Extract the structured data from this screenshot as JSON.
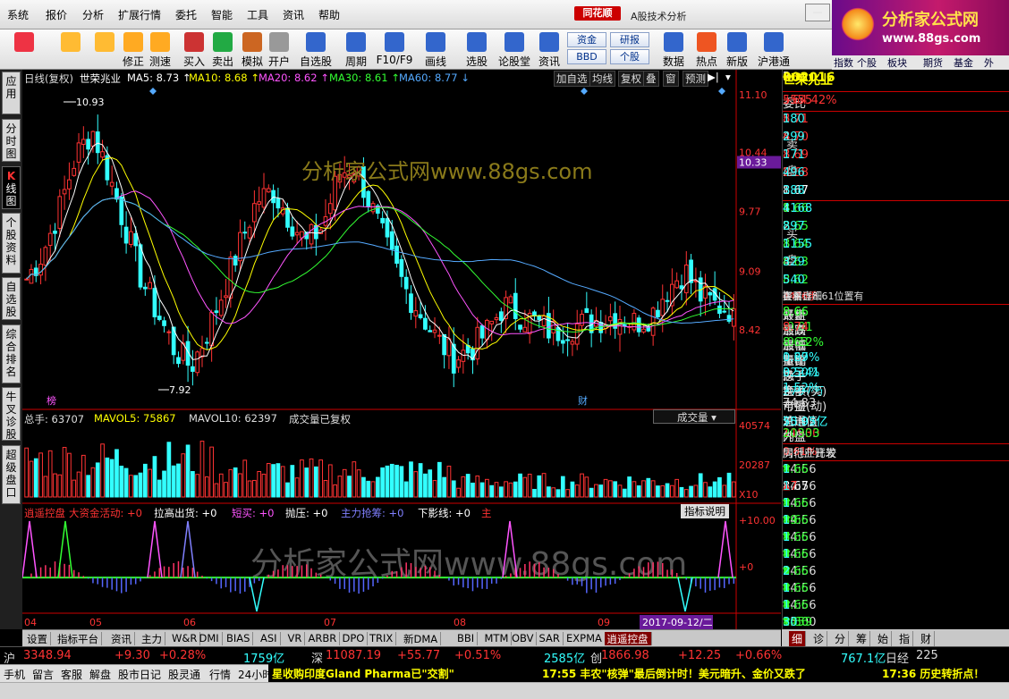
{
  "menu": [
    "系统",
    "报价",
    "分析",
    "扩展行情",
    "委托",
    "智能",
    "工具",
    "资讯",
    "帮助"
  ],
  "app": {
    "logo": "同花顺",
    "title": "A股技术分析",
    "brand_line1": "分析家公式网",
    "brand_line2": "www.88gs.com"
  },
  "toolbar": [
    {
      "label": "",
      "icon": "grid-icon"
    },
    {
      "label": "",
      "icon": "back-arrow-icon"
    },
    {
      "label": "",
      "icon": "up-down-icon"
    },
    {
      "label": "修正",
      "icon": "fix-icon"
    },
    {
      "label": "测速",
      "icon": "clock-icon"
    },
    {
      "label": "买入",
      "icon": "buy-icon"
    },
    {
      "label": "卖出",
      "icon": "sell-icon"
    },
    {
      "label": "模拟",
      "icon": "hammer-icon"
    },
    {
      "label": "开户",
      "icon": "lock-icon"
    },
    {
      "label": "自选股",
      "icon": "star-icon"
    },
    {
      "label": "周期",
      "icon": "period-icon"
    },
    {
      "label": "F10/F9",
      "icon": "f10-icon"
    },
    {
      "label": "画线",
      "icon": "pencil-icon"
    },
    {
      "label": "选股",
      "icon": "select-icon"
    },
    {
      "label": "论股堂",
      "icon": "forum-icon"
    },
    {
      "label": "资讯",
      "icon": "news-icon"
    },
    {
      "label": "数据",
      "icon": "pe-icon"
    },
    {
      "label": "热点",
      "icon": "fire-icon"
    },
    {
      "label": "新版",
      "icon": "newversion-icon"
    },
    {
      "label": "沪港通",
      "icon": "hk-icon"
    }
  ],
  "toolbar_small": [
    "资金",
    "研报",
    "BBD",
    "个股"
  ],
  "right_toolbar": [
    "指数",
    "个股",
    "板块",
    "期货",
    "基金",
    "外"
  ],
  "left_tabs": [
    "应用",
    "分时图",
    "K线图",
    "个股资料",
    "自选股",
    "综合排名",
    "牛叉诊股",
    "超级盘口"
  ],
  "kline_header": {
    "period": "日线(复权)",
    "stock": "世荣兆业",
    "ma": [
      {
        "label": "MA5: 8.73",
        "color": "#ffffff"
      },
      {
        "label": "MA10: 8.68",
        "color": "#ffff00"
      },
      {
        "label": "MA20: 8.62",
        "color": "#ff55ff"
      },
      {
        "label": "MA30: 8.61",
        "color": "#33ff33"
      },
      {
        "label": "MA60: 8.77",
        "color": "#55aaff"
      }
    ],
    "buttons": [
      "加自选",
      "均线",
      "复权",
      "叠",
      "窗",
      "预测"
    ]
  },
  "price_axis": [
    "11.10",
    "10.44",
    "10.33",
    "9.77",
    "9.09",
    "8.42"
  ],
  "current_price_tag": "10.33",
  "high_label": "10.93",
  "low_label": "7.92",
  "markers": [
    "榜",
    "财"
  ],
  "watermark": "分析家公式网www.88gs.com",
  "volume_header": {
    "total": "总手: 63707",
    "mavol5": "MAVOL5: 75867",
    "mavol10": "MAVOL10: 62397",
    "note": "成交量已复权",
    "select": "成交量"
  },
  "volume_axis": [
    "40574",
    "20287",
    "X10"
  ],
  "indicator_header": {
    "name": "逍遥控盘",
    "items": [
      {
        "label": "大资金活动: +0",
        "color": "#ff3333"
      },
      {
        "label": "拉高出货: +0",
        "color": "#ffffff"
      },
      {
        "label": "短买: +0",
        "color": "#ff55ff"
      },
      {
        "label": "抛压: +0",
        "color": "#ffffff"
      },
      {
        "label": "主力抢筹: +0",
        "color": "#8080ff"
      },
      {
        "label": "下影线: +0",
        "color": "#ffffff"
      },
      {
        "label": "主",
        "color": "#ff3333"
      }
    ],
    "help": "指标说明"
  },
  "indicator_axis": [
    "+10.00",
    "+0"
  ],
  "month_labels": [
    "04",
    "05",
    "06",
    "07",
    "08",
    "09"
  ],
  "date_tag": "2017-09-12/二",
  "bottom_tabs": [
    "设置",
    "指标平台",
    "资讯",
    "主力",
    "W&R",
    "DMI",
    "BIAS",
    "ASI",
    "VR",
    "ARBR",
    "DPO",
    "TRIX",
    "新DMA",
    "BBI",
    "MTM",
    "OBV",
    "SAR",
    "EXPMA",
    "逍遥控盘"
  ],
  "right_panel": {
    "title": "世荣兆业",
    "code": "002016",
    "mark": "R",
    "weibi": {
      "label": "委比",
      "value": "+64.42%",
      "vol": "5555"
    },
    "sell_label": "卖盘",
    "buy_label": "买盘",
    "sell": [
      {
        "n": "5",
        "p": "8.71",
        "v": "180"
      },
      {
        "n": "4",
        "p": "8.70",
        "v": "299"
      },
      {
        "n": "3",
        "p": "8.69",
        "v": "171"
      },
      {
        "n": "2",
        "p": "8.68",
        "v": "496"
      },
      {
        "n": "1",
        "p": "8.67",
        "v": "388"
      }
    ],
    "buy": [
      {
        "n": "1",
        "p": "8.66",
        "v": "4168"
      },
      {
        "n": "2",
        "p": "8.65",
        "v": "897"
      },
      {
        "n": "3",
        "p": "8.64",
        "v": "1155"
      },
      {
        "n": "4",
        "p": "8.63",
        "v": "329"
      },
      {
        "n": "5",
        "p": "8.62",
        "v": "540"
      }
    ],
    "buy_position": "在买盘8.61位置有",
    "buy_position_vol": "4476手",
    "buy_single": "买单",
    "detail": "查看详细",
    "stats": [
      {
        "l": "最新",
        "v": "8.66",
        "vc": "#33ff33",
        "l2": "开盘",
        "v2": "8.66",
        "v2c": "#33ff33"
      },
      {
        "l": "涨跌",
        "v": "-0.01",
        "vc": "#33ff33",
        "l2": "最高",
        "v2": "8.74",
        "v2c": "#ff3333"
      },
      {
        "l": "涨幅",
        "v": "-0.12%",
        "vc": "#33ff33",
        "l2": "最低",
        "v2": "8.63",
        "v2c": "#33ff33"
      },
      {
        "l": "振幅",
        "v": "1.27%",
        "vc": "#33ffff",
        "l2": "量比",
        "v2": "0.69",
        "v2c": "#33ffff"
      },
      {
        "l": "总手",
        "v": "32241",
        "vc": "#33ffff",
        "l2": "换手",
        "v2": "0.50%",
        "v2c": "#33ffff"
      },
      {
        "l": "金额",
        "v": "2797万",
        "vc": "#33ffff",
        "l2": "换手(实)",
        "v2": "1.52%",
        "v2c": "#33ffff"
      },
      {
        "l": "市盈",
        "v": "74.83",
        "vc": "#dddddd",
        "l2": "市盈(动)",
        "v2": "亏损",
        "v2c": "#dddddd"
      },
      {
        "l": "总市值",
        "v": "70.07亿",
        "vc": "#33ffff",
        "l2": "流通值",
        "v2": "55.95亿",
        "v2c": "#33ffff"
      },
      {
        "l": "外盘",
        "v": "11930",
        "vc": "#ff3333",
        "l2": "内盘",
        "v2": "20303",
        "v2c": "#33ff33"
      }
    ],
    "industry": {
      "name": "房地产开发",
      "pct": "0.61%",
      "compare": "同行业比较"
    },
    "ticks": [
      {
        "t": "14:56",
        "p": "8.66",
        "pc": "#33ff33",
        "v": "1",
        "d": "down"
      },
      {
        "t": "14:56",
        "p": "8.67",
        "pc": "#ffffff",
        "v": "17",
        "d": "up"
      },
      {
        "t": "14:56",
        "p": "8.66",
        "pc": "#33ff33",
        "v": "5",
        "d": "down"
      },
      {
        "t": "14:56",
        "p": "8.66",
        "pc": "#33ff33",
        "v": "89",
        "d": "down"
      },
      {
        "t": "14:56",
        "p": "8.66",
        "pc": "#33ff33",
        "v": "7",
        "d": "down"
      },
      {
        "t": "14:56",
        "p": "8.66",
        "pc": "#33ff33",
        "v": "4",
        "d": "down"
      },
      {
        "t": "14:56",
        "p": "8.66",
        "pc": "#33ff33",
        "v": "9",
        "d": "down"
      },
      {
        "t": "14:56",
        "p": "8.66",
        "pc": "#33ff33",
        "v": "4",
        "d": "down"
      },
      {
        "t": "14:56",
        "p": "8.66",
        "pc": "#33ff33",
        "v": "4",
        "d": "down"
      },
      {
        "t": "15:00",
        "p": "8.66",
        "pc": "#33ff33",
        "v": "1459",
        "d": "down"
      }
    ],
    "tick_last_col": [
      "1",
      "1",
      "1",
      "1",
      "1",
      "1",
      "2",
      "1",
      "1",
      "30"
    ],
    "tabs": [
      "细",
      "诊",
      "分",
      "筹",
      "始",
      "指",
      "财"
    ]
  },
  "index_bar": {
    "sh_label": "沪",
    "sh_val": "3348.94",
    "sh_chg": "+9.30",
    "sh_pct": "+0.28%",
    "sh_amt": "1759亿",
    "sz_label": "深",
    "sz_val": "11087.19",
    "sz_chg": "+55.77",
    "sz_pct": "+0.51%",
    "sz_amt": "2585亿",
    "cy_label": "创",
    "cy_val": "1866.98",
    "cy_chg": "+12.25",
    "cy_pct": "+0.66%",
    "cy_amt": "767.1亿",
    "rz_label": "日经",
    "rz_val": "225"
  },
  "status_items": [
    "手机",
    "留言",
    "客服",
    "解盘",
    "股市日记",
    "股灵通",
    "行情",
    "24小时滚动"
  ],
  "ticker": [
    {
      "text": "星收购印度Gland Pharma已\"交割\"",
      "color": "#ffff00"
    },
    {
      "text": "17:55 丰农\"核弹\"最后倒计时！美元暗升、金价又跌了",
      "color": "#ffff00"
    },
    {
      "text": "17:36 历史转折点！",
      "color": "#ffff00"
    }
  ],
  "chart_data": {
    "type": "candlestick",
    "price_range": [
      7.7,
      11.2
    ],
    "last_close": 8.66,
    "ma_latest": {
      "MA5": 8.73,
      "MA10": 8.68,
      "MA20": 8.62,
      "MA30": 8.61,
      "MA60": 8.77
    },
    "volume_latest": 63707,
    "volume_range": [
      0,
      40574
    ],
    "indicator_range": [
      -6,
      10
    ]
  }
}
